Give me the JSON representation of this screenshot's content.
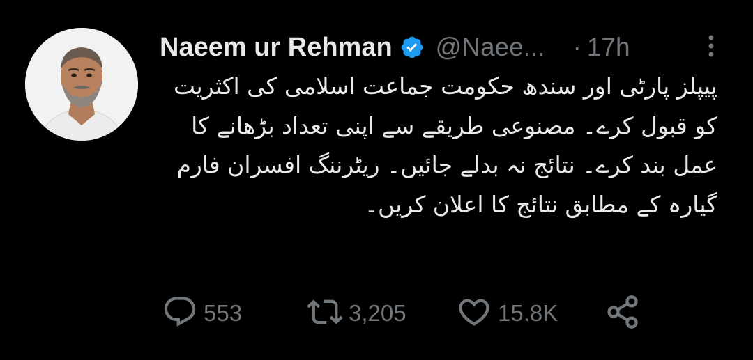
{
  "author": {
    "name": "Naeem ur Rehman",
    "handle": "@Naee...",
    "separator": "·",
    "time": "17h",
    "verified_color": "#1d9bf0"
  },
  "tweet": {
    "text": "پیپلز پارٹی اور سندھ حکومت جماعت اسلامی کی اکثریت کو قبول کرے۔ مصنوعی طریقے سے اپنی تعداد بڑھانے کا عمل بند کرے۔ نتائج نہ بدلے جائیں۔ ریٹرننگ افسران فارم گیارہ کے مطابق نتائج کا اعلان کریں۔"
  },
  "actions": {
    "replies": "553",
    "retweets": "3,205",
    "likes": "15.8K"
  },
  "icons": {
    "verified": "verified-badge-icon",
    "more": "more-vertical-icon",
    "reply": "reply-icon",
    "retweet": "retweet-icon",
    "like": "heart-icon",
    "share": "share-icon"
  },
  "colors": {
    "background": "#000000",
    "text_primary": "#e7e9ea",
    "text_secondary": "#71767b"
  }
}
